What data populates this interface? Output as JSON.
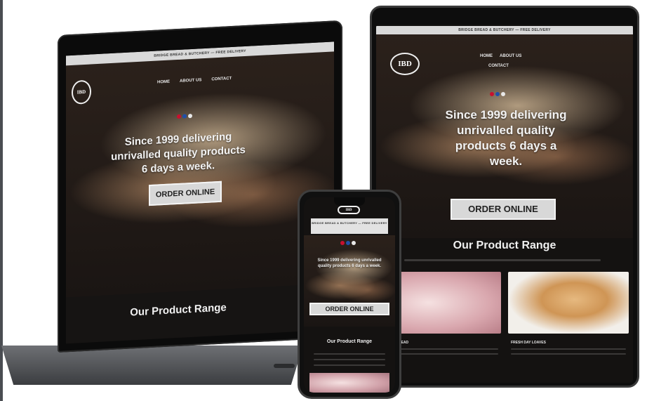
{
  "site": {
    "announcement": "BRIDGE BREAD & BUTCHERY — FREE DELIVERY",
    "logo": "IBD",
    "nav": {
      "home": "HOME",
      "about": "ABOUT US",
      "contact": "CONTACT"
    },
    "hero": {
      "headline": "Since 1999 delivering unrivalled quality products 6 days a week.",
      "order_button": "ORDER ONLINE"
    },
    "product_range": {
      "title": "Our Product Range",
      "products": [
        {
          "title": "FRESH BREAD"
        },
        {
          "title": "FRESH DAY LOAVES"
        }
      ]
    }
  },
  "colors": {
    "background": "#ffffff",
    "site_dark": "#141211",
    "button": "#d8d8d8",
    "announce_bar": "#d9d9d9"
  }
}
